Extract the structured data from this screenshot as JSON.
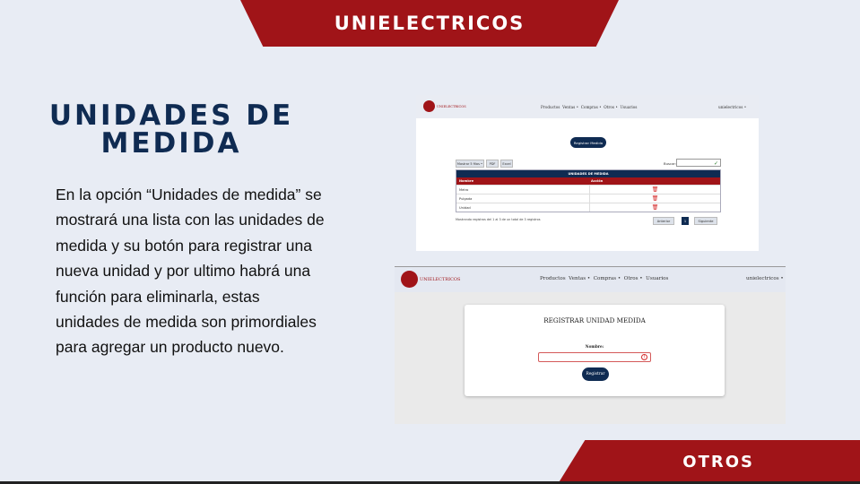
{
  "header": {
    "brand": "UNIELECTRICOS"
  },
  "footer": {
    "label": "OTROS"
  },
  "slide": {
    "title": "UNIDADES DE MEDIDA",
    "description": "En la opción “Unidades de medida” se mostrará una lista con las unidades de medida y su botón para registrar una nueva unidad y por ultimo habrá una función para eliminarla, estas unidades de medida son primordiales para agregar un producto nuevo."
  },
  "app_nav": {
    "logo_text": "UNIELECTRICOS",
    "items": [
      "Productos",
      "Ventas •",
      "Compras •",
      "Otros •",
      "Usuarios"
    ],
    "user": "unielectricos •"
  },
  "list_screen": {
    "register_button": "Registrar Medida",
    "show_button": "Mostrar 5 filas •",
    "pdf_button": "PDF",
    "excel_button": "Excel",
    "search_label": "Buscar:",
    "table_caption": "UNIDADES DE MEDIDA",
    "columns": [
      "Nombre",
      "Acción"
    ],
    "rows": [
      {
        "name": "Metro"
      },
      {
        "name": "Pulgada"
      },
      {
        "name": "Unidad"
      }
    ],
    "info": "Mostrando registros del 1 al 3 de un total de 3 registros",
    "prev_button": "Anterior",
    "page_number": "1",
    "next_button": "Siguiente"
  },
  "form_screen": {
    "title": "REGISTRAR UNIDAD MEDIDA",
    "field_label": "Nombre:",
    "field_value": "",
    "submit_button": "Registrar"
  },
  "colors": {
    "brand_red": "#a01418",
    "navy": "#0f2b52",
    "background": "#e8ecf4"
  },
  "icons": [
    "gear-logo-icon",
    "check-icon",
    "trash-icon",
    "error-icon"
  ]
}
